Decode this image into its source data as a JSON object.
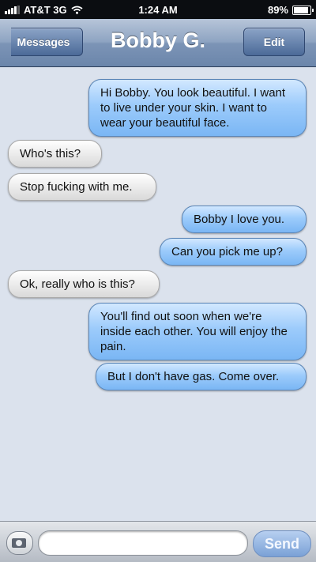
{
  "status_bar": {
    "carrier": "AT&T 3G",
    "time": "1:24 AM",
    "battery": "89%",
    "battery_level": 0.89
  },
  "nav": {
    "back_label": "Messages",
    "title": "Bobby G.",
    "edit_label": "Edit"
  },
  "messages": [
    {
      "direction": "out",
      "text": "Hi Bobby. You look beautiful. I want to live under your skin. I want to wear your beautiful face."
    },
    {
      "direction": "in",
      "text": "Who's this?"
    },
    {
      "direction": "in",
      "text": "Stop fucking with me."
    },
    {
      "direction": "out",
      "text": "Bobby I love you."
    },
    {
      "direction": "out",
      "text": "Can you pick me up?"
    },
    {
      "direction": "in",
      "text": "Ok, really who is this?"
    },
    {
      "direction": "out",
      "text": "You'll find out soon when we're inside each other. You will enjoy the pain."
    },
    {
      "direction": "out",
      "text": "But I don't have gas. Come over."
    }
  ],
  "composer": {
    "send_label": "Send",
    "icon": "camera-icon"
  }
}
